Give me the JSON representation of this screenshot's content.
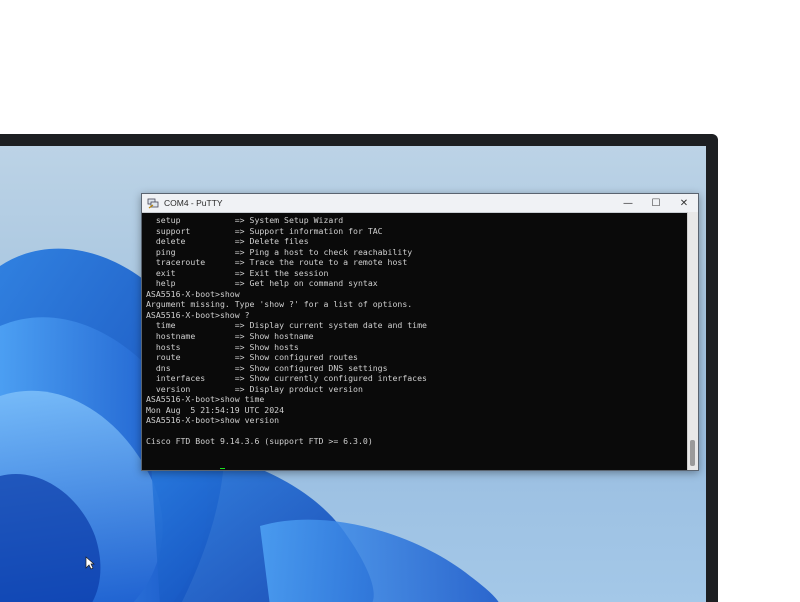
{
  "window": {
    "title": "COM4 - PuTTY",
    "controls": {
      "minimize": "—",
      "maximize": "☐",
      "close": "✕"
    }
  },
  "terminal": {
    "lines": [
      "  setup           => System Setup Wizard",
      "  support         => Support information for TAC",
      "  delete          => Delete files",
      "  ping            => Ping a host to check reachability",
      "  traceroute      => Trace the route to a remote host",
      "  exit            => Exit the session",
      "  help            => Get help on command syntax",
      "ASA5516-X-boot>show",
      "Argument missing. Type 'show ?' for a list of options.",
      "ASA5516-X-boot>show ?",
      "  time            => Display current system date and time",
      "  hostname        => Show hostname",
      "  hosts           => Show hosts",
      "  route           => Show configured routes",
      "  dns             => Show configured DNS settings",
      "  interfaces      => Show currently configured interfaces",
      "  version         => Display product version",
      "ASA5516-X-boot>show time",
      "Mon Aug  5 21:54:19 UTC 2024",
      "ASA5516-X-boot>show version",
      "",
      "Cisco FTD Boot 9.14.3.6 (support FTD >= 6.3.0)",
      "",
      ""
    ],
    "prompt": "ASA5516-X-boot>",
    "cursor_color": "#19e01e",
    "text_color": "#cfcfcf",
    "background_color": "#0a0a0a"
  },
  "icons": {
    "app": "putty-terminal-icon",
    "pointer": "mouse-pointer-icon"
  }
}
